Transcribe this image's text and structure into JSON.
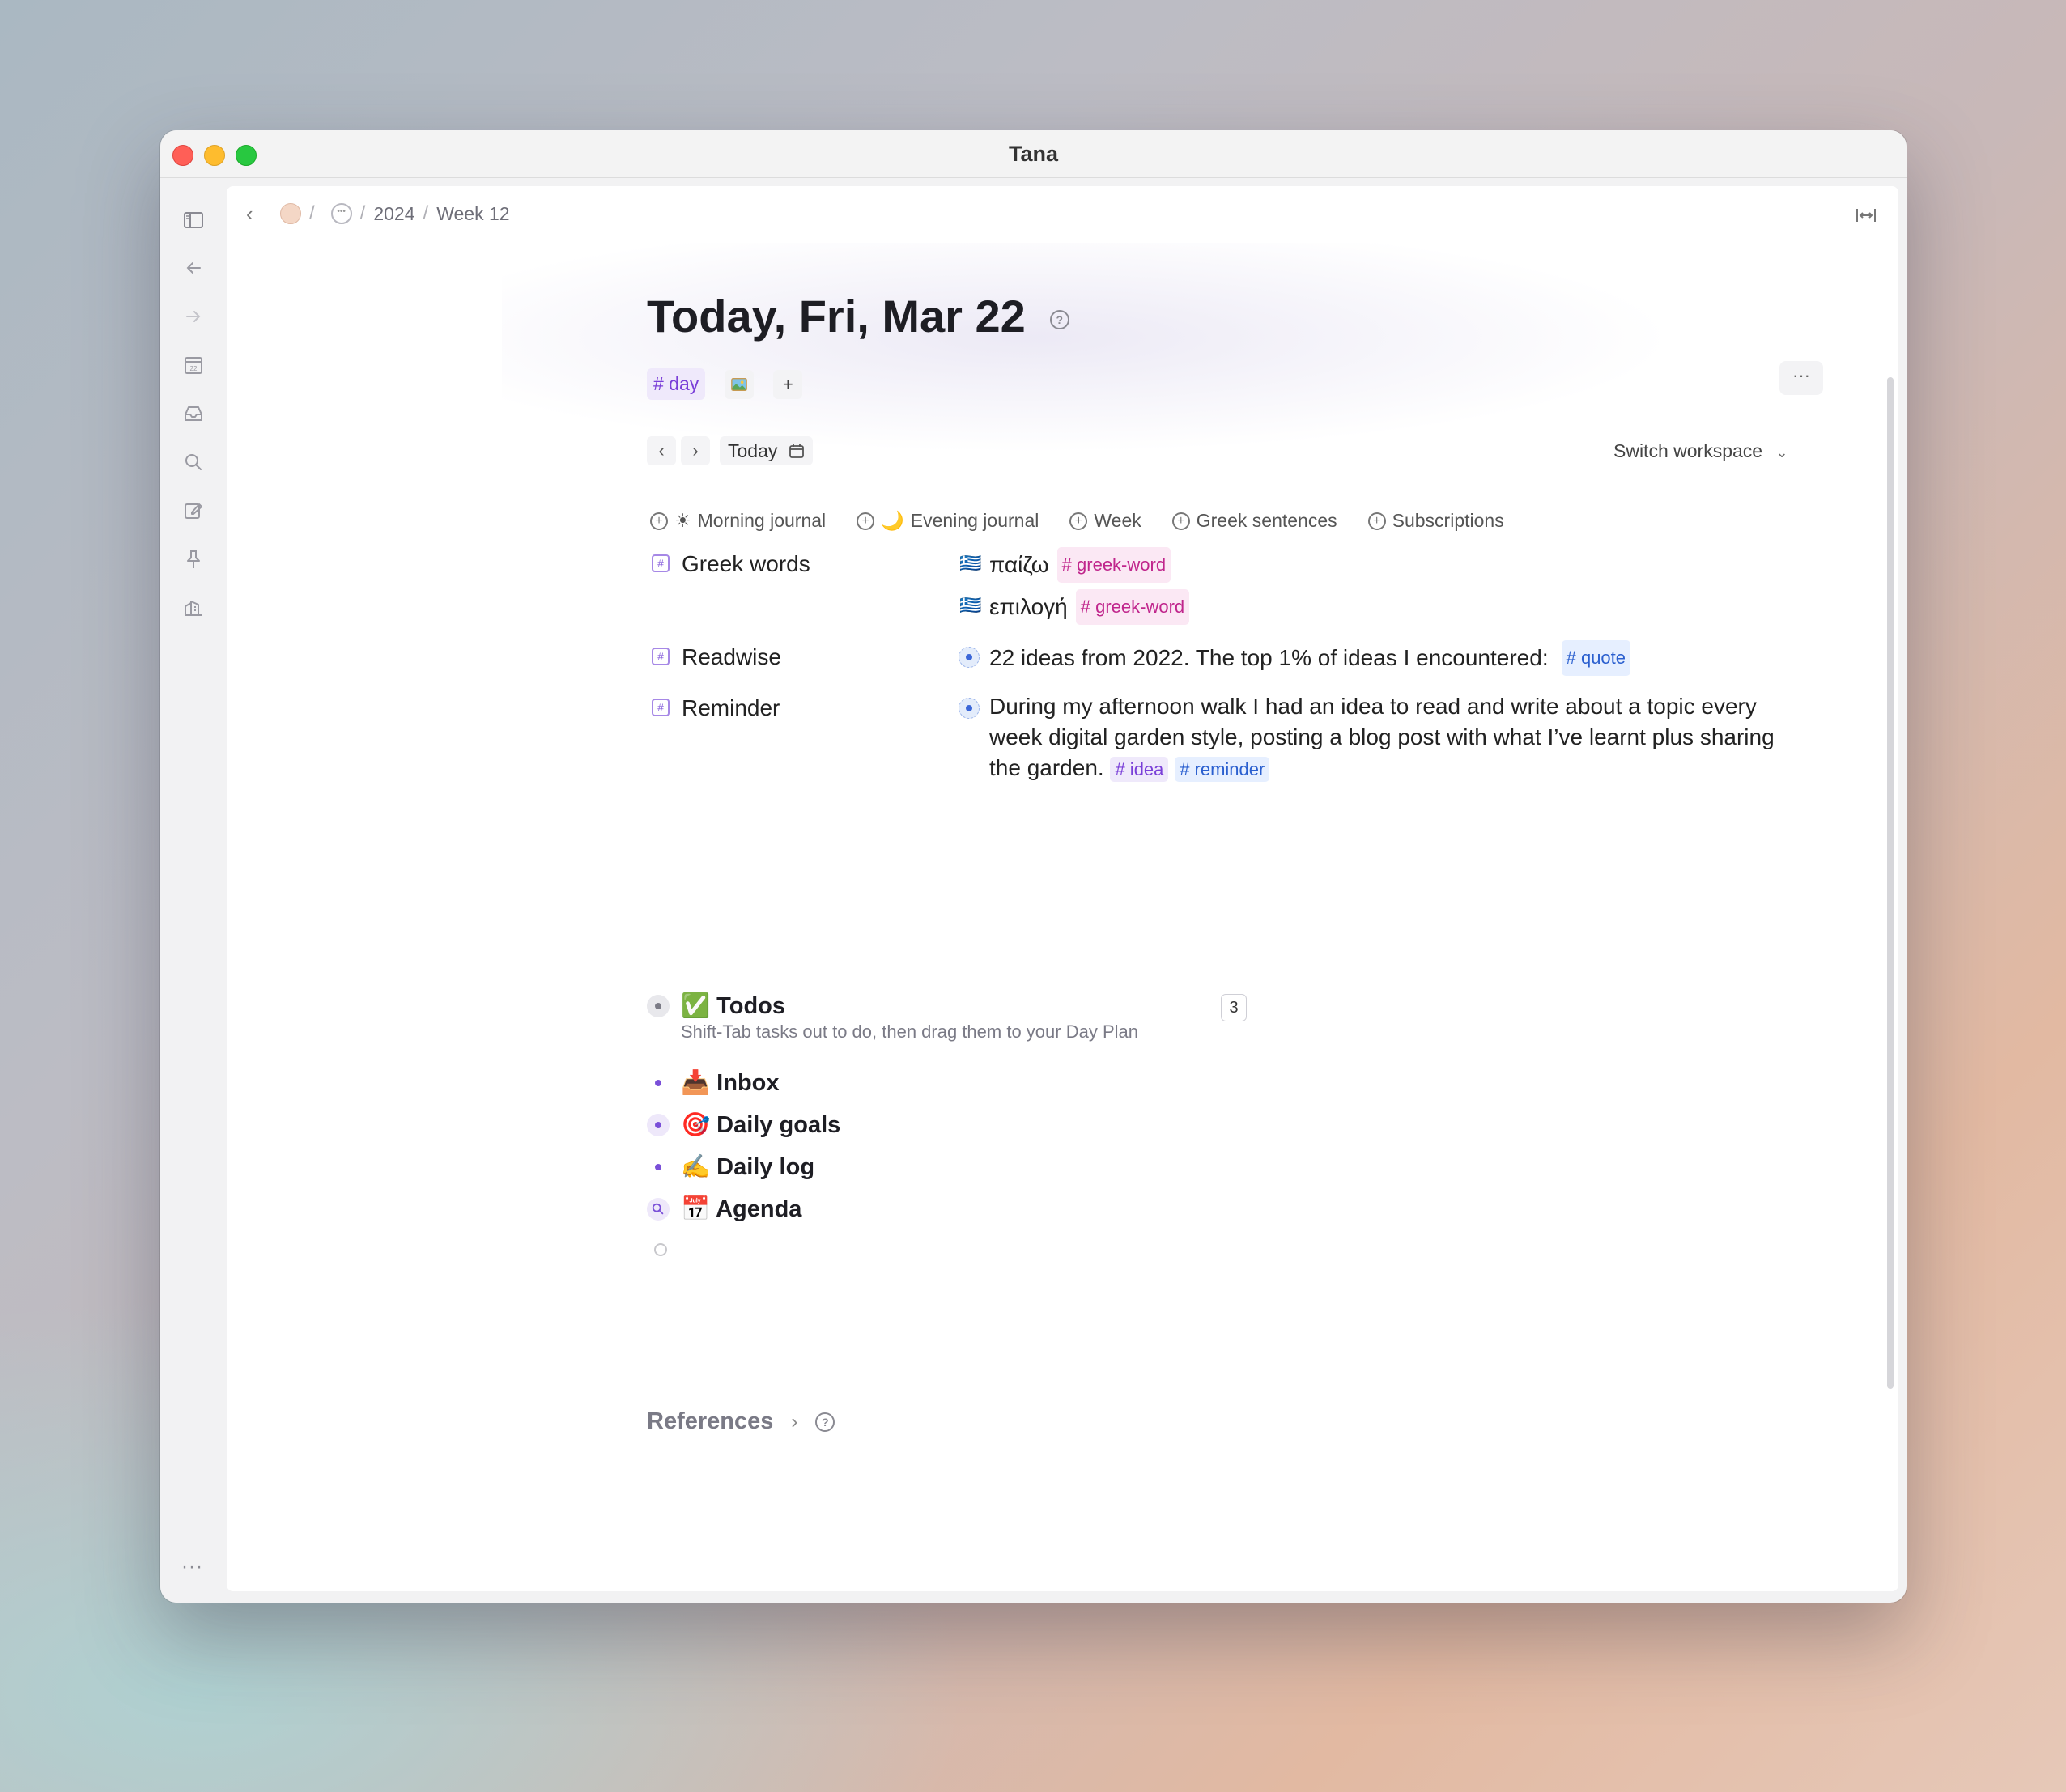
{
  "window": {
    "title": "Tana"
  },
  "breadcrumb": {
    "back_label": "‹",
    "items": [
      "2024",
      "Week 12"
    ]
  },
  "page": {
    "title": "Today, Fri, Mar 22",
    "help": "?",
    "tag": "# day",
    "image_icon": "image-icon",
    "add_label": "+",
    "more_label": "···"
  },
  "date_nav": {
    "prev": "‹",
    "next": "›",
    "today_label": "Today"
  },
  "switch_workspace": "Switch workspace",
  "quick_add": [
    {
      "prefix": "☀",
      "label": "Morning journal"
    },
    {
      "prefix": "🌙",
      "label": "Evening journal"
    },
    {
      "prefix": "",
      "label": "Week"
    },
    {
      "prefix": "",
      "label": "Greek sentences"
    },
    {
      "prefix": "",
      "label": "Subscriptions"
    }
  ],
  "fields": {
    "greek": {
      "name": "Greek words",
      "values": [
        {
          "text": "παίζω",
          "tag": "# greek-word"
        },
        {
          "text": "επιλογή",
          "tag": "# greek-word"
        }
      ]
    },
    "readwise": {
      "name": "Readwise",
      "text": "22 ideas from 2022.  The top 1% of ideas I encountered:",
      "tag": "# quote"
    },
    "reminder": {
      "name": "Reminder",
      "text": "During my afternoon walk I had an idea to read and write about a topic every week digital garden style, posting a blog post with what I’ve learnt plus sharing the garden.",
      "tags": [
        "# idea",
        "# reminder"
      ]
    }
  },
  "nodes": {
    "todos": {
      "emoji": "✅",
      "label": "Todos",
      "description": "Shift-Tab tasks out to do, then drag them to your Day Plan",
      "count": "3"
    },
    "inbox": {
      "emoji": "📥",
      "label": "Inbox"
    },
    "daily_goals": {
      "emoji": "🎯",
      "label": "Daily goals"
    },
    "daily_log": {
      "emoji": "✍️",
      "label": "Daily log"
    },
    "agenda": {
      "emoji": "📅",
      "label": "Agenda"
    }
  },
  "references": {
    "label": "References",
    "chevron": "›",
    "help": "?"
  },
  "sidebar": {
    "more": "···"
  },
  "colors": {
    "accent": "#7a3fd8",
    "tag_pink": "#c0258c",
    "tag_blue": "#2a5fcf"
  }
}
